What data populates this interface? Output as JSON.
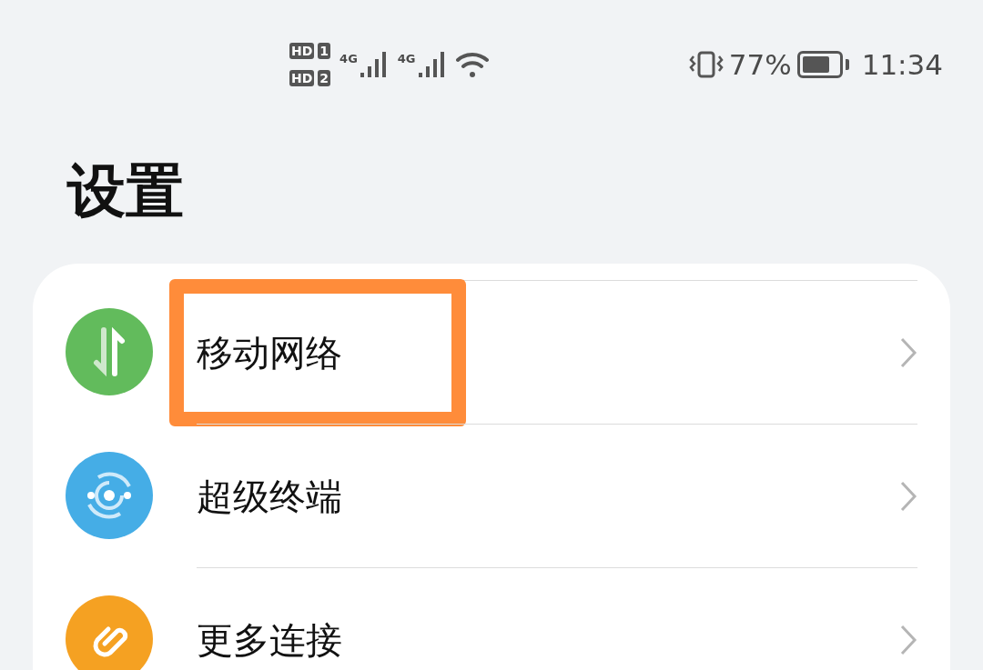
{
  "status_bar": {
    "sim_labels": [
      {
        "text": "HD",
        "slot": "1"
      },
      {
        "text": "HD",
        "slot": "2"
      }
    ],
    "networks": [
      "4G",
      "4G"
    ],
    "battery": {
      "percent": "77%"
    },
    "time": "11:34"
  },
  "title": "设置",
  "items": [
    {
      "label": "移动网络",
      "kind": "network",
      "color": "#62bb5c",
      "highlighted": true
    },
    {
      "label": "超级终端",
      "kind": "devices",
      "color": "#45ade6",
      "highlighted": false
    },
    {
      "label": "更多连接",
      "kind": "link",
      "color": "#f5a122",
      "highlighted": false
    }
  ]
}
